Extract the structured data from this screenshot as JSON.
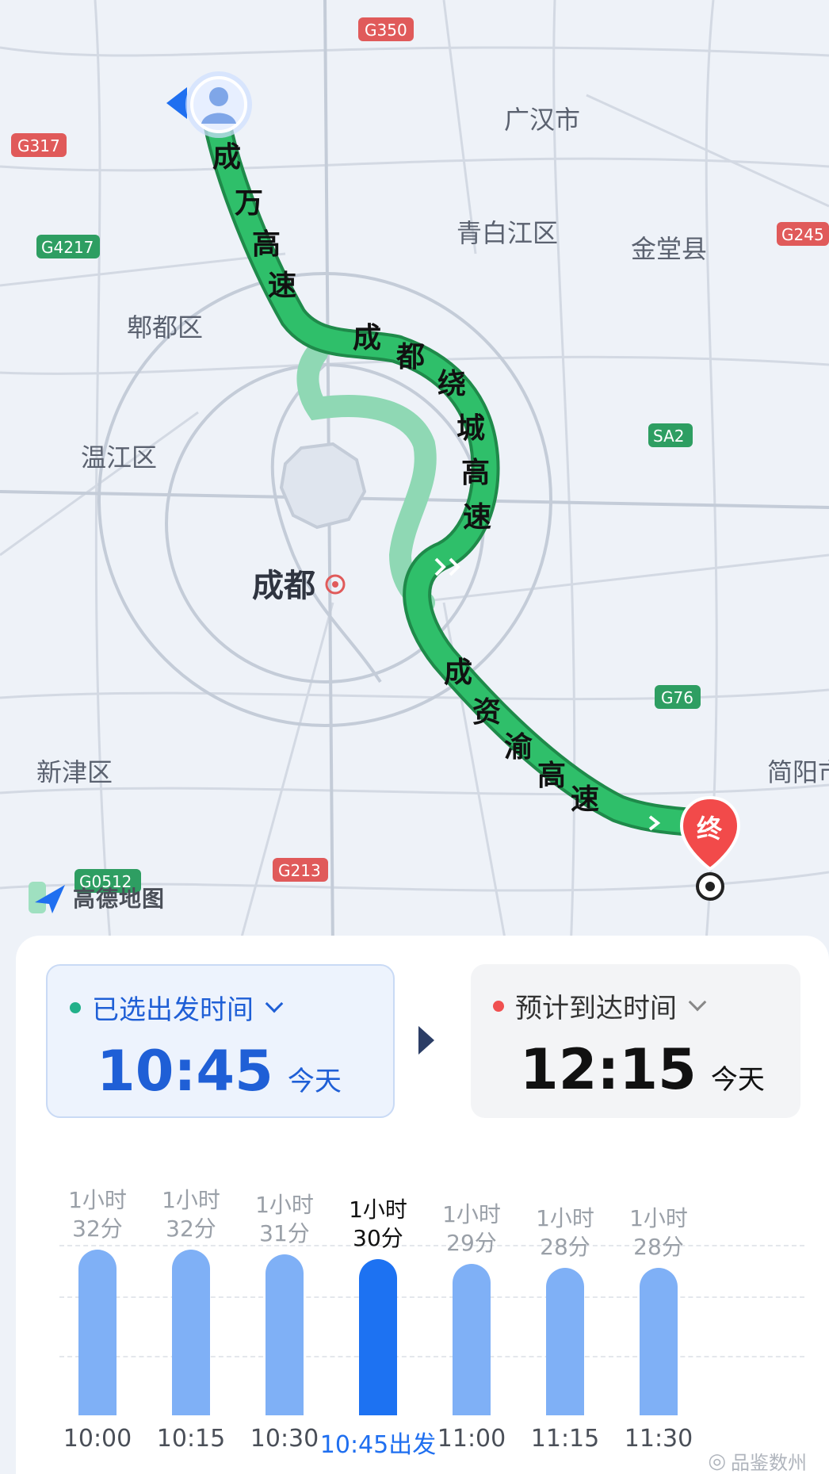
{
  "map": {
    "places": [
      "广汉市",
      "青白江区",
      "金堂县",
      "郫都区",
      "温江区",
      "新津区",
      "简阳市"
    ],
    "city": "成都",
    "shields": {
      "g350": "G350",
      "g317": "G317",
      "g4217": "G4217",
      "g245": "G245",
      "sa2": "SA2",
      "g76": "G76",
      "g213": "G213",
      "g0512": "G0512"
    },
    "roads": {
      "chengwan": [
        "成",
        "万",
        "高",
        "速"
      ],
      "raocheng": [
        "成",
        "都",
        "绕",
        "城",
        "高",
        "速"
      ],
      "chengziyu": [
        "成",
        "资",
        "渝",
        "高",
        "速"
      ]
    },
    "end_marker": "终",
    "route_color": "#22a85a",
    "alt_route_color": "#8fd8b4"
  },
  "brand": {
    "logo_text": "高德地图"
  },
  "departure": {
    "title": "已选出发时间",
    "time": "10:45",
    "day": "今天",
    "dot_color": "#22b08a"
  },
  "arrival": {
    "title": "预计到达时间",
    "time": "12:15",
    "day": "今天",
    "dot_color": "#f05050"
  },
  "chart_data": {
    "type": "bar",
    "categories": [
      "10:00",
      "10:15",
      "10:30",
      "10:45出发",
      "11:00",
      "11:15",
      "11:30"
    ],
    "values": [
      92,
      92,
      91,
      90,
      89,
      88,
      88
    ],
    "unit": "minutes",
    "labels_line1": [
      "1小时",
      "1小时",
      "1小时",
      "1小时",
      "1小时",
      "1小时",
      "1小时"
    ],
    "labels_line2": [
      "32分",
      "32分",
      "31分",
      "30分",
      "29分",
      "28分",
      "28分"
    ],
    "selected_index": 3,
    "ylim": [
      0,
      92
    ],
    "bar_color": "#7fb0f6",
    "selected_color": "#1d72f2"
  },
  "watermark": {
    "text": "品鉴数州"
  }
}
